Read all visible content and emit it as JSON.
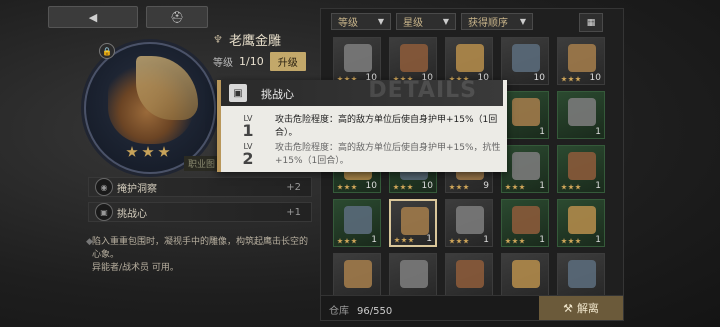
{
  "top_buttons": [
    {
      "icon": "back-arrow-icon"
    },
    {
      "icon": "helmet-icon"
    }
  ],
  "item": {
    "name": "老鹰金雕",
    "level_label": "等级",
    "level_value": "1/10",
    "upgrade_label": "升级",
    "stars": 3,
    "profession_tag": "职业图"
  },
  "skills": [
    {
      "label": "掩护洞察",
      "value": "+2"
    },
    {
      "label": "挑战心",
      "value": "+1"
    }
  ],
  "description": {
    "line1": "陷入重重包围时，凝视手中的雕像，构筑起鹰击长空的心象。",
    "line2": "异能者/战术员 可用。"
  },
  "filters": [
    {
      "label": "等级"
    },
    {
      "label": "星级"
    },
    {
      "label": "获得顺序"
    }
  ],
  "tooltip": {
    "title": "挑战心",
    "watermark": "DETAILS",
    "levels": [
      {
        "lv_label": "LV",
        "lv_num": "1",
        "text": "攻击危险程度：高的敌方单位后使自身护甲+15%（1回合）。"
      },
      {
        "lv_label": "LV",
        "lv_num": "2",
        "text": "攻击危险程度：高的敌方单位后使自身护甲+15%，抗性+15%（1回合）。"
      }
    ]
  },
  "inventory": {
    "rows": [
      [
        {
          "count": "10",
          "green": false,
          "stars": 3
        },
        {
          "count": "10",
          "green": false,
          "stars": 3
        },
        {
          "count": "10",
          "green": false,
          "stars": 3
        },
        {
          "count": "10",
          "green": false,
          "stars": 0
        },
        {
          "count": "10",
          "green": false,
          "stars": 3
        }
      ],
      [
        {
          "count": "",
          "green": false,
          "stars": 0
        },
        {
          "count": "",
          "green": false,
          "stars": 0
        },
        {
          "count": "",
          "green": false,
          "stars": 0
        },
        {
          "count": "1",
          "green": true,
          "stars": 0
        },
        {
          "count": "1",
          "green": true,
          "stars": 0
        }
      ],
      [
        {
          "count": "10",
          "green": true,
          "stars": 3
        },
        {
          "count": "10",
          "green": true,
          "stars": 3
        },
        {
          "count": "9",
          "green": false,
          "stars": 3
        },
        {
          "count": "1",
          "green": true,
          "stars": 3
        },
        {
          "count": "1",
          "green": true,
          "stars": 3
        }
      ],
      [
        {
          "count": "1",
          "green": true,
          "stars": 3
        },
        {
          "count": "1",
          "green": false,
          "stars": 3
        },
        {
          "count": "1",
          "green": false,
          "stars": 3
        },
        {
          "count": "1",
          "green": true,
          "stars": 3
        },
        {
          "count": "1",
          "green": true,
          "stars": 3
        }
      ],
      [
        {
          "count": "",
          "green": false,
          "stars": 0
        },
        {
          "count": "",
          "green": false,
          "stars": 0
        },
        {
          "count": "",
          "green": false,
          "stars": 0
        },
        {
          "count": "",
          "green": false,
          "stars": 0
        },
        {
          "count": "",
          "green": false,
          "stars": 0
        }
      ]
    ],
    "selected": {
      "row": 3,
      "col": 1
    },
    "storage_label": "仓库",
    "storage_value": "96/550",
    "dismantle_label": "解离"
  },
  "colors": {
    "accent": "#c3a86a",
    "panel": "#1f1f1f",
    "tooltip_bg": "#ecebe6"
  }
}
